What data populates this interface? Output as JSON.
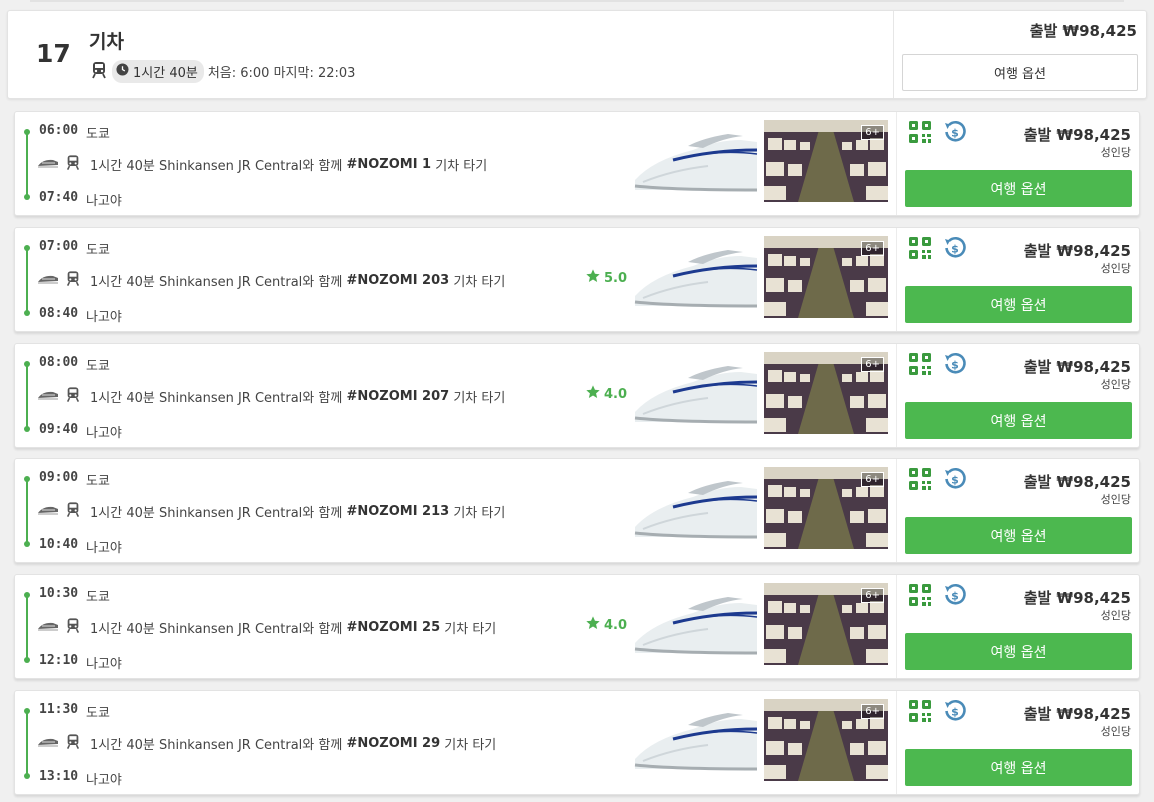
{
  "summary": {
    "count": "17",
    "mode": "기차",
    "duration": "1시간 40분",
    "first_last": "처음: 6:00 마지막: 22:03",
    "from_price": "출발 ₩98,425",
    "options_label": "여행 옵션"
  },
  "trips": [
    {
      "dep_time": "06:00",
      "dep_place": "도쿄",
      "arr_time": "07:40",
      "arr_place": "나고야",
      "duration": "1시간 40분",
      "operator": "Shinkansen JR Central와 함께",
      "train": "#NOZOMI 1",
      "suffix": "기차 타기",
      "rating": "",
      "age": "6+",
      "price": "출발 ₩98,425",
      "per": "성인당",
      "button": "여행 옵션"
    },
    {
      "dep_time": "07:00",
      "dep_place": "도쿄",
      "arr_time": "08:40",
      "arr_place": "나고야",
      "duration": "1시간 40분",
      "operator": "Shinkansen JR Central와 함께",
      "train": "#NOZOMI 203",
      "suffix": "기차 타기",
      "rating": "5.0",
      "age": "6+",
      "price": "출발 ₩98,425",
      "per": "성인당",
      "button": "여행 옵션"
    },
    {
      "dep_time": "08:00",
      "dep_place": "도쿄",
      "arr_time": "09:40",
      "arr_place": "나고야",
      "duration": "1시간 40분",
      "operator": "Shinkansen JR Central와 함께",
      "train": "#NOZOMI 207",
      "suffix": "기차 타기",
      "rating": "4.0",
      "age": "6+",
      "price": "출발 ₩98,425",
      "per": "성인당",
      "button": "여행 옵션"
    },
    {
      "dep_time": "09:00",
      "dep_place": "도쿄",
      "arr_time": "10:40",
      "arr_place": "나고야",
      "duration": "1시간 40분",
      "operator": "Shinkansen JR Central와 함께",
      "train": "#NOZOMI 213",
      "suffix": "기차 타기",
      "rating": "",
      "age": "6+",
      "price": "출발 ₩98,425",
      "per": "성인당",
      "button": "여행 옵션"
    },
    {
      "dep_time": "10:30",
      "dep_place": "도쿄",
      "arr_time": "12:10",
      "arr_place": "나고야",
      "duration": "1시간 40분",
      "operator": "Shinkansen JR Central와 함께",
      "train": "#NOZOMI 25",
      "suffix": "기차 타기",
      "rating": "4.0",
      "age": "6+",
      "price": "출발 ₩98,425",
      "per": "성인당",
      "button": "여행 옵션"
    },
    {
      "dep_time": "11:30",
      "dep_place": "도쿄",
      "arr_time": "13:10",
      "arr_place": "나고야",
      "duration": "1시간 40분",
      "operator": "Shinkansen JR Central와 함께",
      "train": "#NOZOMI 29",
      "suffix": "기차 타기",
      "rating": "",
      "age": "6+",
      "price": "출발 ₩98,425",
      "per": "성인당",
      "button": "여행 옵션"
    }
  ],
  "colors": {
    "accent": "#4cb84f",
    "refund_icon": "#4a8bb8",
    "interior": "#3b2f3a"
  },
  "icons": [
    "train-icon",
    "clock-icon",
    "carrier-logo-icon",
    "qr-ticket-icon",
    "refund-icon",
    "star-icon"
  ]
}
